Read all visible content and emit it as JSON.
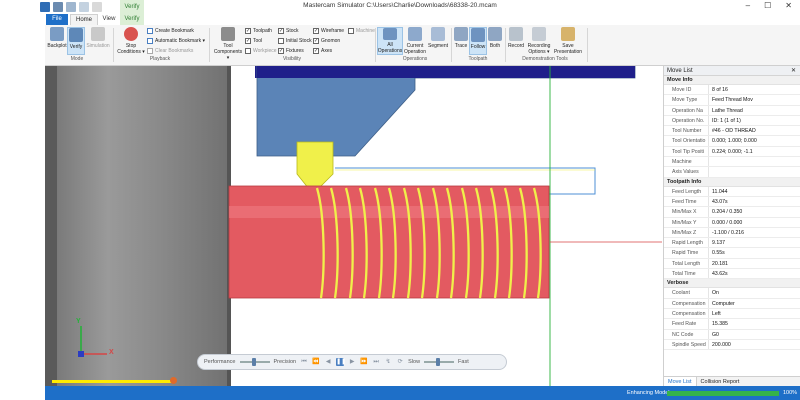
{
  "window": {
    "title": "Mastercam Simulator  C:\\Users\\Charlie\\Downloads\\68338-20.mcam",
    "context_tab": "Verify",
    "controls": [
      "–",
      "☐",
      "✕"
    ]
  },
  "tabs": [
    "File",
    "Home",
    "View",
    "Verify"
  ],
  "ribbon": {
    "mode": {
      "label": "Mode",
      "buttons": [
        "Backplot",
        "Verify",
        "Simulation"
      ]
    },
    "playback": {
      "label": "Playback",
      "stop_conditions": "Stop Conditions ▾",
      "items": [
        "Create Bookmark",
        "Automatic Bookmark ▾",
        "Clear Bookmarks"
      ]
    },
    "visibility": {
      "label": "Visibility",
      "tool_components": "Tool Components ▾",
      "col1": [
        "Toolpath",
        "Tool",
        "Workpiece"
      ],
      "col2": [
        "Stock",
        "Initial Stock",
        "Fixtures"
      ],
      "col3": [
        "Wireframe",
        "Gnomon",
        "Axes"
      ],
      "col4": [
        "Machine"
      ]
    },
    "operations": {
      "label": "Operations",
      "buttons": [
        "All Operations",
        "Current Operation",
        "Segment"
      ]
    },
    "toolpath": {
      "label": "Toolpath",
      "buttons": [
        "Trace",
        "Follow",
        "Both"
      ]
    },
    "demonstration": {
      "label": "Demonstration Tools",
      "buttons": [
        "Record",
        "Recording Options ▾",
        "Save Presentation"
      ]
    }
  },
  "navbar": {
    "performance": "Performance",
    "precision": "Precision",
    "slow": "Slow",
    "fast": "Fast"
  },
  "axes": {
    "x": "X",
    "y": "Y"
  },
  "move_list": {
    "title": "Move List",
    "sections": [
      {
        "name": "Move Info",
        "rows": [
          [
            "Move ID",
            "8 of 16"
          ],
          [
            "Move Type",
            "Feed Thread Mov"
          ],
          [
            "Operation Na",
            "Lathe Thread"
          ],
          [
            "Operation No.",
            "ID: 1 (1 of 1)"
          ],
          [
            "Tool Number",
            "#46 - OD THREAD"
          ],
          [
            "Tool Orientatio",
            "0.000; 1.000; 0.000"
          ],
          [
            "Tool Tip Positi",
            "0.224; 0.000; -1.1"
          ],
          [
            "Machine",
            ""
          ],
          [
            "Axis Values",
            ""
          ]
        ]
      },
      {
        "name": "Toolpath Info",
        "rows": [
          [
            "Feed Length",
            "11.044"
          ],
          [
            "Feed Time",
            "43.07s"
          ],
          [
            "Min/Max X",
            "0.204 / 0.350"
          ],
          [
            "Min/Max Y",
            "0.000 / 0.000"
          ],
          [
            "Min/Max Z",
            "-1.100 / 0.216"
          ],
          [
            "Rapid Length",
            "9.137"
          ],
          [
            "Rapid Time",
            "0.55s"
          ],
          [
            "Total Length",
            "20.181"
          ],
          [
            "Total Time",
            "43.62s"
          ]
        ]
      },
      {
        "name": "Verbose",
        "rows": [
          [
            "Coolant",
            "On"
          ],
          [
            "Compensation",
            "Computer"
          ],
          [
            "Compensation",
            "Left"
          ],
          [
            "Feed Rate",
            "15.385"
          ],
          [
            "NC Code",
            "G0"
          ],
          [
            "Spindle Speed",
            "200.000"
          ]
        ]
      }
    ],
    "bottom_tabs": [
      "Move List",
      "Collision Report"
    ]
  },
  "status": {
    "label": "Enhancing Model",
    "percent_text": "100%",
    "progress": 1.0
  },
  "colors": {
    "accent": "#1e6fc8",
    "stock": "#e35a61",
    "thread": "#f0f04a",
    "holder": "#5b84b7",
    "path": "#9ab0d8"
  }
}
